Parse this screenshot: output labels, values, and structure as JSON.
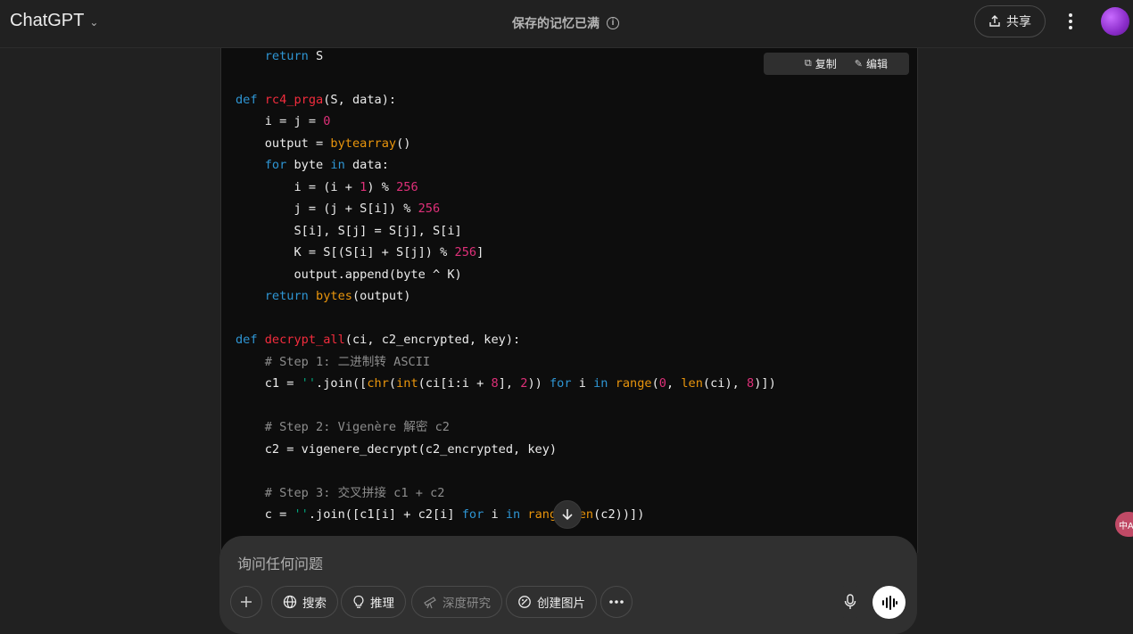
{
  "header": {
    "model_name": "ChatGPT",
    "memory_status": "保存的记忆已满",
    "share_label": "共享"
  },
  "code_block": {
    "copy_label": "复制",
    "edit_label": "编辑"
  },
  "composer": {
    "placeholder": "询问任何问题",
    "tools": {
      "search": "搜索",
      "reason": "推理",
      "deep_research": "深度研究",
      "create_image": "创建图片"
    }
  },
  "translate_badge": "中A",
  "colors": {
    "keyword": "#2e95d3",
    "function_name": "#f22c3d",
    "builtin": "#e9950c",
    "number": "#df3079",
    "string": "#00a67d",
    "comment": "#8d8d8d"
  },
  "icons": {
    "header": [
      "chevron-down-icon",
      "info-icon",
      "share-icon",
      "more-vertical-icon",
      "avatar"
    ],
    "composer": [
      "plus-icon",
      "globe-icon",
      "lightbulb-icon",
      "telescope-icon",
      "image-create-icon",
      "more-horizontal-icon",
      "mic-icon",
      "voice-waveform-icon"
    ],
    "code": [
      "copy-icon",
      "edit-icon",
      "arrow-down-icon"
    ]
  }
}
